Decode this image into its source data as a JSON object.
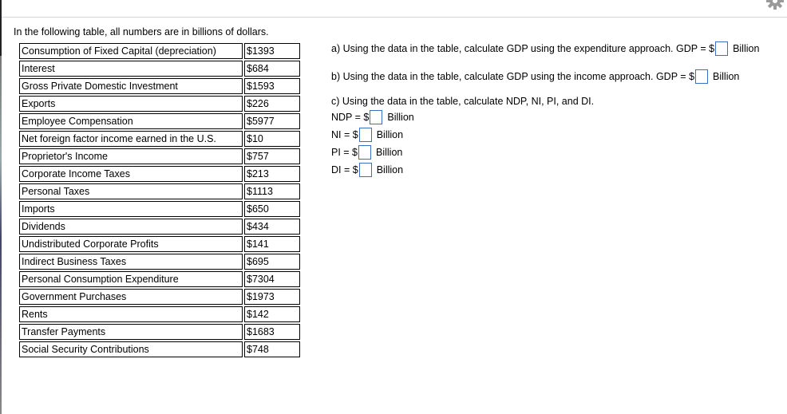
{
  "intro": "In the following table, all numbers are in billions of dollars.",
  "table": {
    "rows": [
      {
        "label": "Consumption of Fixed Capital (depreciation)",
        "value": "$1393"
      },
      {
        "label": "Interest",
        "value": "$684"
      },
      {
        "label": "Gross Private Domestic Investment",
        "value": "$1593"
      },
      {
        "label": "Exports",
        "value": "$226"
      },
      {
        "label": "Employee Compensation",
        "value": "$5977"
      },
      {
        "label": "Net foreign factor income earned in the U.S.",
        "value": "$10"
      },
      {
        "label": "Proprietor's Income",
        "value": "$757"
      },
      {
        "label": "Corporate Income Taxes",
        "value": "$213"
      },
      {
        "label": "Personal Taxes",
        "value": "$1113"
      },
      {
        "label": "Imports",
        "value": "$650"
      },
      {
        "label": "Dividends",
        "value": "$434"
      },
      {
        "label": "Undistributed Corporate Profits",
        "value": "$141"
      },
      {
        "label": "Indirect Business Taxes",
        "value": "$695"
      },
      {
        "label": "Personal Consumption Expenditure",
        "value": "$7304"
      },
      {
        "label": "Government Purchases",
        "value": "$1973"
      },
      {
        "label": "Rents",
        "value": "$142"
      },
      {
        "label": "Transfer Payments",
        "value": "$1683"
      },
      {
        "label": "Social Security Contributions",
        "value": "$748"
      }
    ]
  },
  "questions": {
    "a": {
      "text": "a) Using the data in the table, calculate GDP using the expenditure approach.  GDP = $",
      "value": "",
      "unit": "Billion"
    },
    "b": {
      "text": "b) Using the data in the table, calculate GDP using the income approach.  GDP = $",
      "value": "",
      "unit": "Billion"
    },
    "c": {
      "text": "c) Using the data in the table, calculate NDP, NI, PI, and DI.",
      "fields": [
        {
          "label": "NDP = $",
          "value": "",
          "unit": "Billion"
        },
        {
          "label": "NI = $",
          "value": "",
          "unit": "Billion"
        },
        {
          "label": "PI = $",
          "value": "",
          "unit": "Billion"
        },
        {
          "label": "DI = $",
          "value": "",
          "unit": "Billion"
        }
      ]
    }
  },
  "icons": {
    "settings": "gear-icon"
  }
}
